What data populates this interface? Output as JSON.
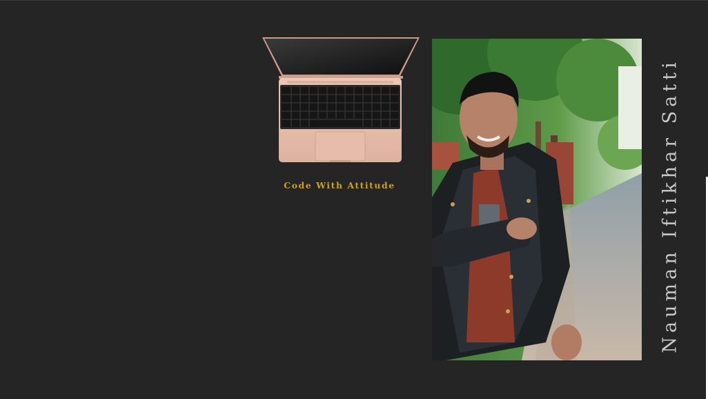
{
  "tagline": "Code With Attitude",
  "name": "Nauman Iftikhar Satti",
  "colors": {
    "background": "#252525",
    "tagline": "#c9a21c",
    "name": "#c8c8c8",
    "laptop_body": "#e5b9a6"
  },
  "images": {
    "laptop": "laptop-illustration",
    "portrait": "portrait-photo"
  }
}
